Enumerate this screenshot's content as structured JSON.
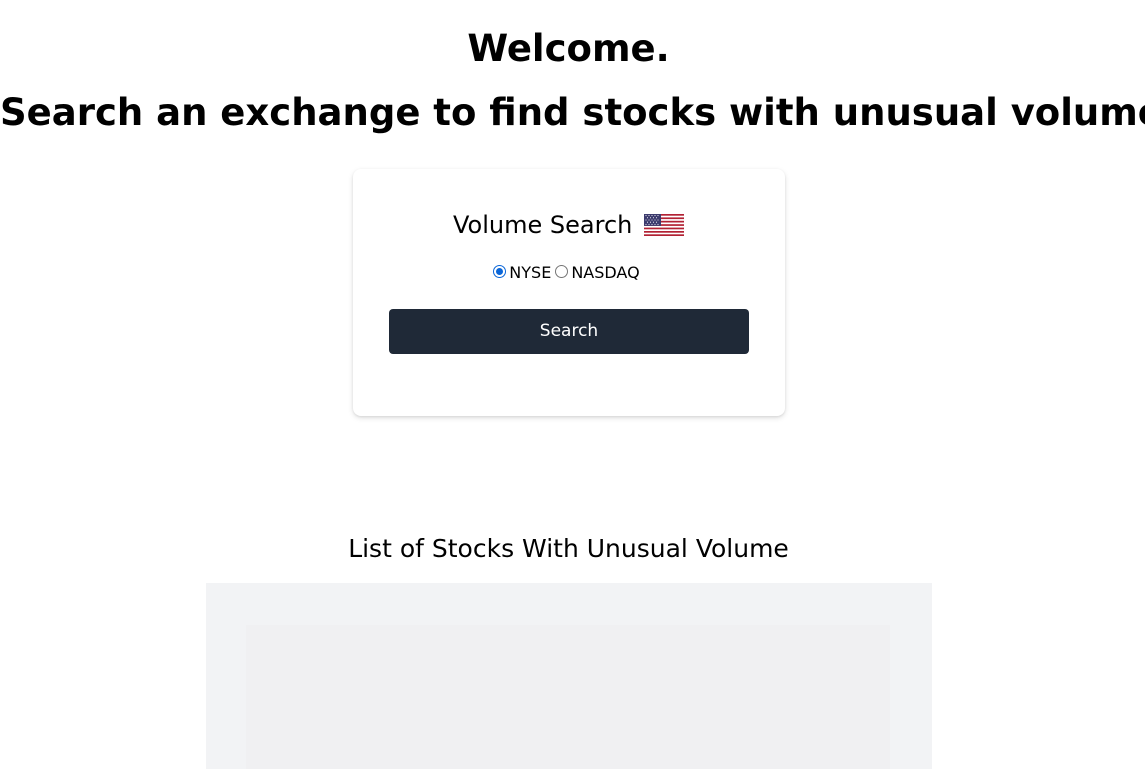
{
  "hero": {
    "line1": "Welcome.",
    "line2": "Search an exchange to find stocks with unusual volume."
  },
  "search_card": {
    "title": "Volume Search",
    "flag_icon": "us-flag-icon",
    "exchanges": [
      {
        "label": "NYSE",
        "checked": true
      },
      {
        "label": "NASDAQ",
        "checked": false
      }
    ],
    "button_label": "Search"
  },
  "results": {
    "title": "List of Stocks With Unusual Volume"
  },
  "colors": {
    "button_bg": "#1f2937",
    "radio_accent": "#0a66d8",
    "panel_bg": "#f2f3f5"
  }
}
